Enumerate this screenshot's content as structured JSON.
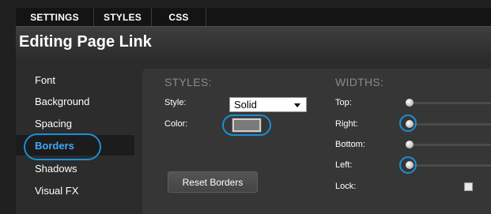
{
  "tabs": [
    "SETTINGS",
    "STYLES",
    "CSS"
  ],
  "header": {
    "title": "Editing Page Link"
  },
  "sidebar": {
    "items": [
      {
        "label": "Font",
        "active": false
      },
      {
        "label": "Background",
        "active": false
      },
      {
        "label": "Spacing",
        "active": false
      },
      {
        "label": "Borders",
        "active": true
      },
      {
        "label": "Shadows",
        "active": false
      },
      {
        "label": "Visual FX",
        "active": false
      }
    ]
  },
  "styles": {
    "title": "STYLES:",
    "style_label": "Style:",
    "style_value": "Solid",
    "color_label": "Color:",
    "color_value": "#7a7a7a",
    "reset_label": "Reset Borders"
  },
  "widths": {
    "title": "WIDTHS:",
    "top_label": "Top:",
    "right_label": "Right:",
    "bottom_label": "Bottom:",
    "left_label": "Left:",
    "lock_label": "Lock:",
    "lock_checked": false
  },
  "colors": {
    "accent": "#3fa9f5",
    "highlight_ring": "#1a8fd8",
    "panel": "#363636",
    "tabbar": "#141414"
  }
}
